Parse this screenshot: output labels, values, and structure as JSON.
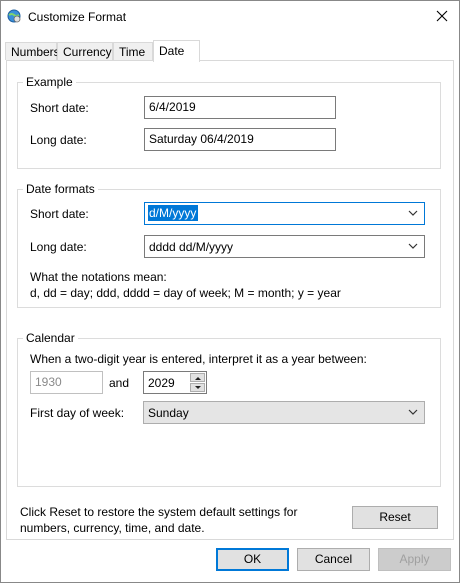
{
  "window": {
    "title": "Customize Format"
  },
  "tabs": [
    {
      "label": "Numbers"
    },
    {
      "label": "Currency"
    },
    {
      "label": "Time"
    },
    {
      "label": "Date"
    }
  ],
  "example": {
    "title": "Example",
    "short_label": "Short date:",
    "short_value": "6/4/2019",
    "long_label": "Long date:",
    "long_value": "Saturday 06/4/2019"
  },
  "formats": {
    "title": "Date formats",
    "short_label": "Short date:",
    "short_value": "d/M/yyyy",
    "long_label": "Long date:",
    "long_value": "dddd dd/M/yyyy",
    "notation_title": "What the notations mean:",
    "notation_text": "d, dd = day;  ddd, dddd = day of week;  M = month;  y = year"
  },
  "calendar": {
    "title": "Calendar",
    "twodigit_text": "When a two-digit year is entered, interpret it as a year between:",
    "from_year": "1930",
    "and_label": "and",
    "to_year": "2029",
    "firstday_label": "First day of week:",
    "firstday_value": "Sunday"
  },
  "reset": {
    "text_line1": "Click Reset to restore the system default settings for",
    "text_line2": "numbers, currency, time, and date.",
    "button": "Reset"
  },
  "footer": {
    "ok": "OK",
    "cancel": "Cancel",
    "apply": "Apply"
  },
  "colors": {
    "accent": "#0078d7",
    "border": "#dcdcdc"
  },
  "icons": {
    "app": "globe-settings-icon",
    "close": "close-icon",
    "dropdown": "chevron-down-icon",
    "spin_up": "spin-up-icon",
    "spin_down": "spin-down-icon"
  }
}
